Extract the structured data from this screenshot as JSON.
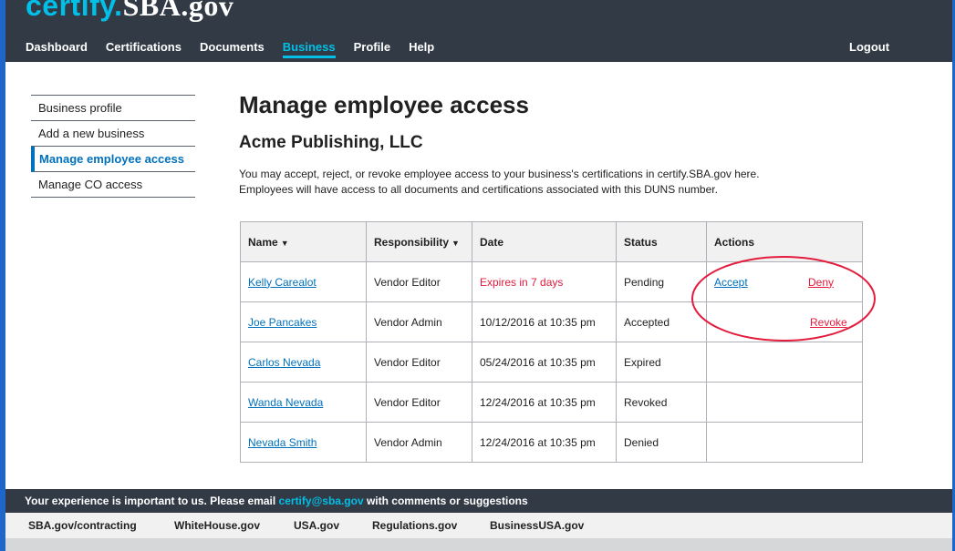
{
  "header": {
    "logo_part1": "certify.",
    "logo_part2": "SBA.gov",
    "nav": [
      "Dashboard",
      "Certifications",
      "Documents",
      "Business",
      "Profile",
      "Help"
    ],
    "active_nav": "Business",
    "logout": "Logout"
  },
  "sidebar": {
    "items": [
      "Business profile",
      "Add a new business",
      "Manage employee access",
      "Manage CO access"
    ],
    "active": "Manage employee access"
  },
  "main": {
    "title": "Manage employee access",
    "subtitle": "Acme Publishing, LLC",
    "description_line1": "You may accept, reject, or revoke employee access to your business's certifications in certify.SBA.gov here.",
    "description_line2": "Employees will have access to all documents and certifications associated with this DUNS number."
  },
  "table": {
    "headers": {
      "name": "Name",
      "responsibility": "Responsibility",
      "date": "Date",
      "status": "Status",
      "actions": "Actions"
    },
    "rows": [
      {
        "name": "Kelly Carealot",
        "responsibility": "Vendor Editor",
        "date": "Expires in 7 days",
        "status": "Pending",
        "accept": "Accept",
        "deny": "Deny"
      },
      {
        "name": "Joe Pancakes",
        "responsibility": "Vendor Admin",
        "date": "10/12/2016 at 10:35 pm",
        "status": "Accepted",
        "revoke": "Revoke"
      },
      {
        "name": "Carlos Nevada",
        "responsibility": "Vendor Editor",
        "date": "05/24/2016 at 10:35 pm",
        "status": "Expired"
      },
      {
        "name": "Wanda Nevada",
        "responsibility": "Vendor Editor",
        "date": "12/24/2016 at 10:35 pm",
        "status": "Revoked"
      },
      {
        "name": "Nevada Smith",
        "responsibility": "Vendor Admin",
        "date": "12/24/2016 at 10:35 pm",
        "status": "Denied"
      }
    ]
  },
  "footer": {
    "message_before": "Your experience is important to us. Please email ",
    "email": "certify@sba.gov",
    "message_after": " with comments or suggestions",
    "links": [
      "SBA.gov/contracting",
      "WhiteHouse.gov",
      "USA.gov",
      "Regulations.gov",
      "BusinessUSA.gov"
    ]
  },
  "colors": {
    "header_bg": "#323a45",
    "accent_cyan": "#02bfe7",
    "link_blue": "#0071bc",
    "alert_red": "#e31c3d",
    "frame_blue": "#1f66c9"
  }
}
